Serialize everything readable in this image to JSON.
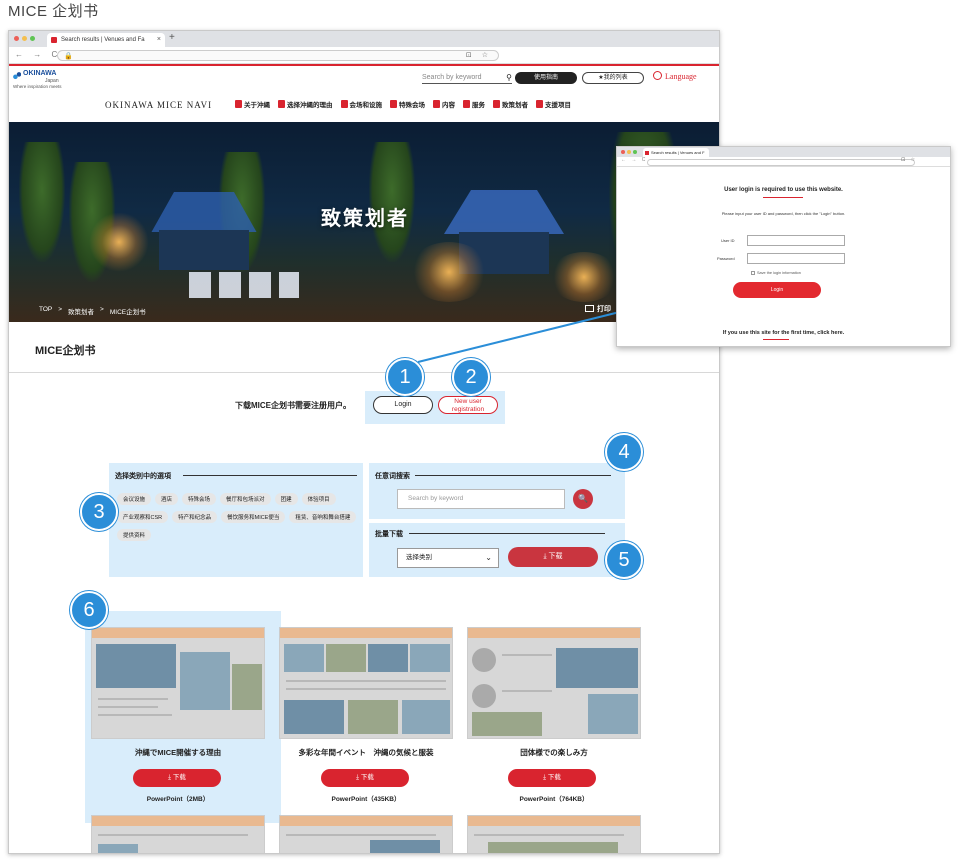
{
  "page_title": "MICE 企划书",
  "browser": {
    "tab_title": "Search results | Venues and Fa",
    "tab_close": "×",
    "new_tab": "+",
    "nav_icons": "← → C",
    "lock": "🔒",
    "omnibox_icons": "⊡ ☆"
  },
  "header": {
    "logo_main": "OKINAWA",
    "logo_sub": "Japan",
    "logo_tag": "Where inspiration meets",
    "search_placeholder": "Search by keyword",
    "guide_btn": "使用指南",
    "mylist_btn": "★我的列表",
    "language": "Language",
    "site_name": "OKINAWA MICE NAVI",
    "nav": [
      {
        "label": "关于沖縄"
      },
      {
        "label": "选择沖縄的理由"
      },
      {
        "label": "会场和设施"
      },
      {
        "label": "特殊会场"
      },
      {
        "label": "内容"
      },
      {
        "label": "服务"
      },
      {
        "label": "致策划者"
      },
      {
        "label": "支援项目"
      }
    ]
  },
  "hero": {
    "title": "致策划者",
    "breadcrumb": [
      "TOP",
      ">",
      "致策划者",
      ">",
      "MICE企划书"
    ],
    "print": "打印"
  },
  "section_title": "MICE企划书",
  "login": {
    "note": "下载MICE企划书需要注册用户。",
    "login_btn": "Login",
    "register_btn_line1": "New user",
    "register_btn_line2": "registration"
  },
  "category": {
    "title": "选择类别中的選項",
    "chips": [
      "会议设施",
      "酒店",
      "特殊会场",
      "餐厅和包场派对",
      "团建",
      "体验项目",
      "产业观察和CSR",
      "特产和纪念品",
      "餐饮服务和MICE便当",
      "租赁、音响和舞台搭建",
      "提供资料"
    ]
  },
  "keyword": {
    "title": "任意词搜索",
    "placeholder": "Search by keyword",
    "btn_icon": "🔍"
  },
  "bulk": {
    "title": "批量下载",
    "select_value": "选择类别",
    "chev": "⌄",
    "btn": "⤓  下载"
  },
  "cards": [
    {
      "title": "沖縄でMICE開催する理由",
      "btn": "⤓  下载",
      "size": "PowerPoint（2MB）"
    },
    {
      "title": "多彩な年間イベント　沖縄の気候と服装",
      "btn": "⤓  下载",
      "size": "PowerPoint（435KB）"
    },
    {
      "title": "団体様での楽しみ方",
      "btn": "⤓  下载",
      "size": "PowerPoint（764KB）"
    }
  ],
  "popup": {
    "tab_title": "Search results | Venues and F",
    "nav_icons": "← → C",
    "omnibox_icons": "⊡ ☆",
    "required": "User login is required to use this website.",
    "help": "Please input your user ID and password, then click the \"Login\" button.",
    "user_id_label": "User ID",
    "password_label": "Password",
    "save_label": "Save the login information",
    "login_btn": "Login",
    "first_time": "If you use this site for the first time, click here."
  },
  "callouts": [
    "1",
    "2",
    "3",
    "4",
    "5",
    "6"
  ],
  "colors": {
    "accent_red": "#d9242f",
    "callout_blue": "#2b8ed8",
    "highlight": "#d7ebf8"
  }
}
